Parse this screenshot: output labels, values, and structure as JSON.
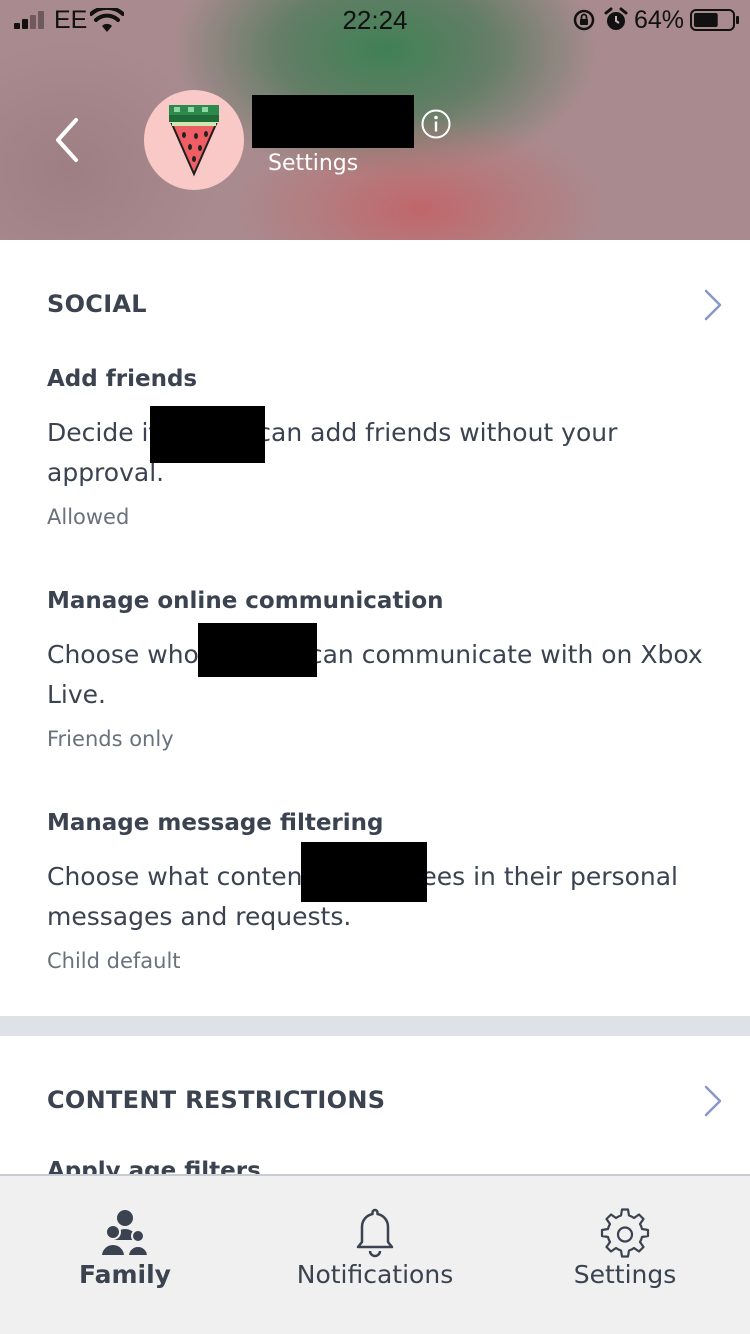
{
  "status_bar": {
    "carrier": "EE",
    "time": "22:24",
    "battery": "64%",
    "battery_level": 0.64
  },
  "header": {
    "subtitle": "Settings",
    "name": ""
  },
  "sections": {
    "social": {
      "title": "SOCIAL",
      "items": [
        {
          "title": "Add friends",
          "desc_before": "Decide if",
          "desc_after": "can add friends without your approval.",
          "value": "Allowed"
        },
        {
          "title": "Manage online communication",
          "desc_before": "Choose who",
          "desc_after": "can communicate with on Xbox Live.",
          "value": "Friends only"
        },
        {
          "title": "Manage message filtering",
          "desc_before": "Choose what content",
          "desc_after": "sees in their personal messages and requests.",
          "value": "Child default"
        }
      ]
    },
    "content": {
      "title": "CONTENT RESTRICTIONS",
      "first_item_title": "Apply age filters"
    }
  },
  "tab_bar": {
    "tabs": [
      {
        "label": "Family",
        "icon": "family-icon",
        "active": true
      },
      {
        "label": "Notifications",
        "icon": "bell-icon",
        "active": false
      },
      {
        "label": "Settings",
        "icon": "gear-icon",
        "active": false
      }
    ]
  },
  "colors": {
    "text": "#3b4250",
    "muted": "#6b717c",
    "chevron": "#8a97c7",
    "band": "#dee2e7",
    "tab_bg": "#f0f0f1"
  }
}
